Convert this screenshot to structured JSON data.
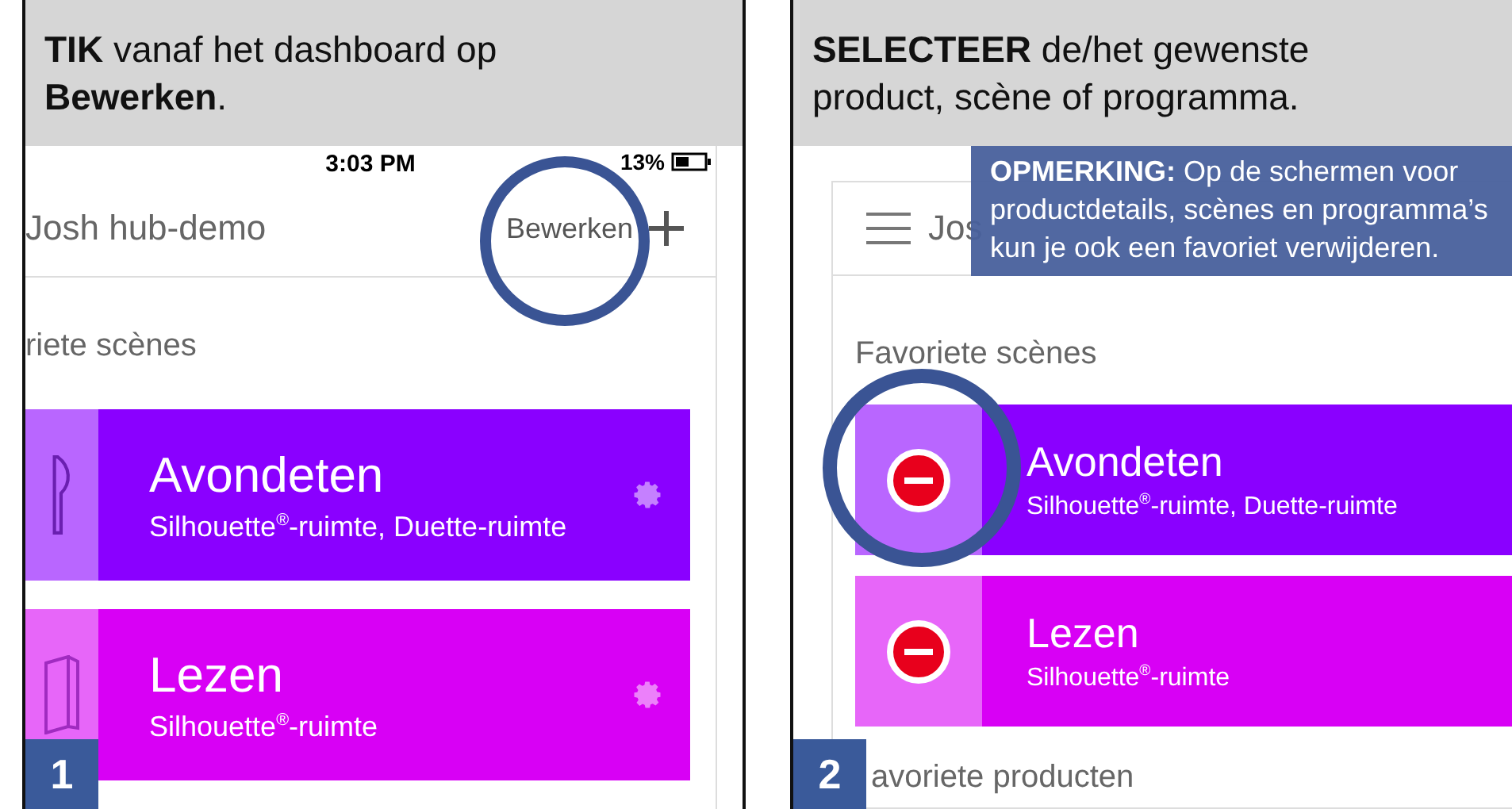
{
  "panels": [
    {
      "step": "1",
      "instruction": "**TIK** vanaf het dashboard op **Bewerken**.",
      "time": "3:03 PM",
      "battery": "13%",
      "hub": "Josh hub-demo",
      "edit": "Bewerken",
      "section": "riete scènes",
      "editing": false,
      "scenes": [
        {
          "name": "Avondeten",
          "rooms": "Silhouette$^{®}$-ruimte, Duette-ruimte",
          "color": "#8a00ff"
        },
        {
          "name": "Lezen",
          "rooms": "Silhouette$^{®}$-ruimte",
          "color": "#d800f5"
        }
      ]
    },
    {
      "step": "2",
      "instruction": "**SELECTEER** de/het gewenste product, scène of programma.",
      "hub": "Jos",
      "note": "**OPMERKING:** Op de schermen voor productdetails, scènes en programma’s kun je ook een favoriet verwijderen.",
      "section": "Favoriete scènes",
      "editing": true,
      "scenes": [
        {
          "name": "Avondeten",
          "rooms": "Silhouette$^{®}$-ruimte, Duette-ruimte",
          "color": "#8a00ff"
        },
        {
          "name": "Lezen",
          "rooms": "Silhouette$^{®}$-ruimte",
          "color": "#d800f5"
        }
      ],
      "next_section": "avoriete producten"
    }
  ]
}
